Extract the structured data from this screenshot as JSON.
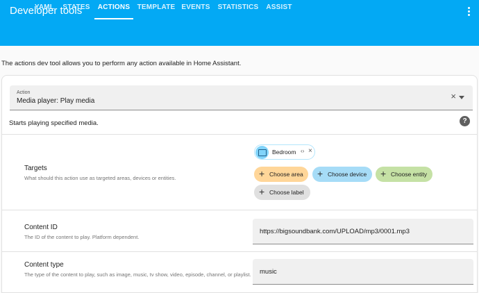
{
  "header": {
    "title": "Developer tools",
    "tabs": [
      {
        "label": "YAML",
        "active": false
      },
      {
        "label": "STATES",
        "active": false
      },
      {
        "label": "ACTIONS",
        "active": true
      },
      {
        "label": "TEMPLATE",
        "active": false
      },
      {
        "label": "EVENTS",
        "active": false
      },
      {
        "label": "STATISTICS",
        "active": false
      },
      {
        "label": "ASSIST",
        "active": false
      }
    ]
  },
  "intro": "The actions dev tool allows you to perform any action available in Home Assistant.",
  "action_select": {
    "label": "Action",
    "value": "Media player: Play media"
  },
  "action_description": "Starts playing specified media.",
  "targets": {
    "title": "Targets",
    "description": "What should this action use as targeted areas, devices or entities.",
    "selected_device": "Bedroom",
    "buttons": {
      "area": "Choose area",
      "device": "Choose device",
      "entity": "Choose entity",
      "label": "Choose label"
    }
  },
  "content_id": {
    "title": "Content ID",
    "description": "The ID of the content to play. Platform dependent.",
    "value": "https://bigsoundbank.com/UPLOAD/mp3/0001.mp3"
  },
  "content_type": {
    "title": "Content type",
    "description": "The type of the content to play, such as image, music, tv show, video, episode, channel, or playlist.",
    "value": "music"
  },
  "colors": {
    "header": "#03a9f4",
    "area": "#ffd699",
    "device": "#a6dcf7",
    "entity": "#c5e1a5",
    "label": "#e0e0e0"
  }
}
